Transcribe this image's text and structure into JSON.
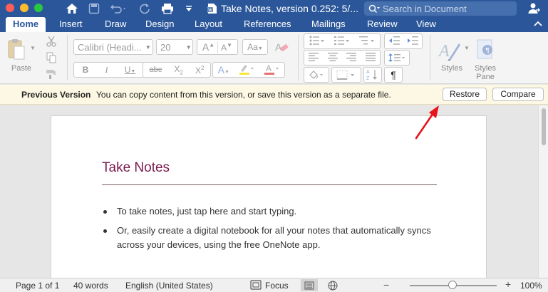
{
  "window": {
    "title": "Take Notes, version 0.252: 5/...",
    "search_placeholder": "Search in Document"
  },
  "tabs": [
    "Home",
    "Insert",
    "Draw",
    "Design",
    "Layout",
    "References",
    "Mailings",
    "Review",
    "View"
  ],
  "active_tab": "Home",
  "ribbon": {
    "paste_label": "Paste",
    "font_name": "Calibri (Headi...",
    "font_size": "20",
    "styles_label": "Styles",
    "styles_pane_label": "Styles Pane"
  },
  "infobar": {
    "title": "Previous Version",
    "message": "You can copy content from this version, or save this version as a separate file.",
    "restore_label": "Restore",
    "compare_label": "Compare"
  },
  "document": {
    "heading": "Take Notes",
    "bullets": [
      "To take notes, just tap here and start typing.",
      "Or, easily create a digital notebook for all your notes that automatically syncs across your devices, using the free OneNote app."
    ]
  },
  "statusbar": {
    "page": "Page 1 of 1",
    "words": "40 words",
    "language": "English (United States)",
    "focus": "Focus",
    "zoom": "100%",
    "zoom_value": 100
  },
  "colors": {
    "title_bar": "#2b579a",
    "heading": "#7a1a4f",
    "infobar_bg": "#fcf8e3",
    "annotation_arrow": "#e8141b"
  }
}
